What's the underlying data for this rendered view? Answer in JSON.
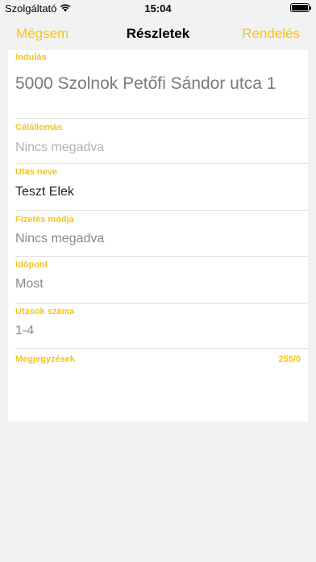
{
  "status_bar": {
    "carrier": "Szolgáltató",
    "time": "15:04"
  },
  "nav": {
    "cancel": "Mégsem",
    "title": "Részletek",
    "order": "Rendelés"
  },
  "form": {
    "start": {
      "label": "Indulás",
      "value": "5000 Szolnok Petőfi Sándor utca 1"
    },
    "destination": {
      "label": "Célállomás",
      "placeholder": "Nincs megadva"
    },
    "passenger_name": {
      "label": "Utas neve",
      "value": "Teszt Elek"
    },
    "payment": {
      "label": "Fizetés módja",
      "value": "Nincs megadva"
    },
    "time": {
      "label": "Időpont",
      "value": "Most"
    },
    "passenger_count": {
      "label": "Utasok száma",
      "value": "1-4"
    },
    "note": {
      "label": "Megjegyzések",
      "counter": "255/0"
    }
  },
  "colors": {
    "accent": "#f5c518",
    "background": "#f2f2f2",
    "card": "#ffffff"
  }
}
